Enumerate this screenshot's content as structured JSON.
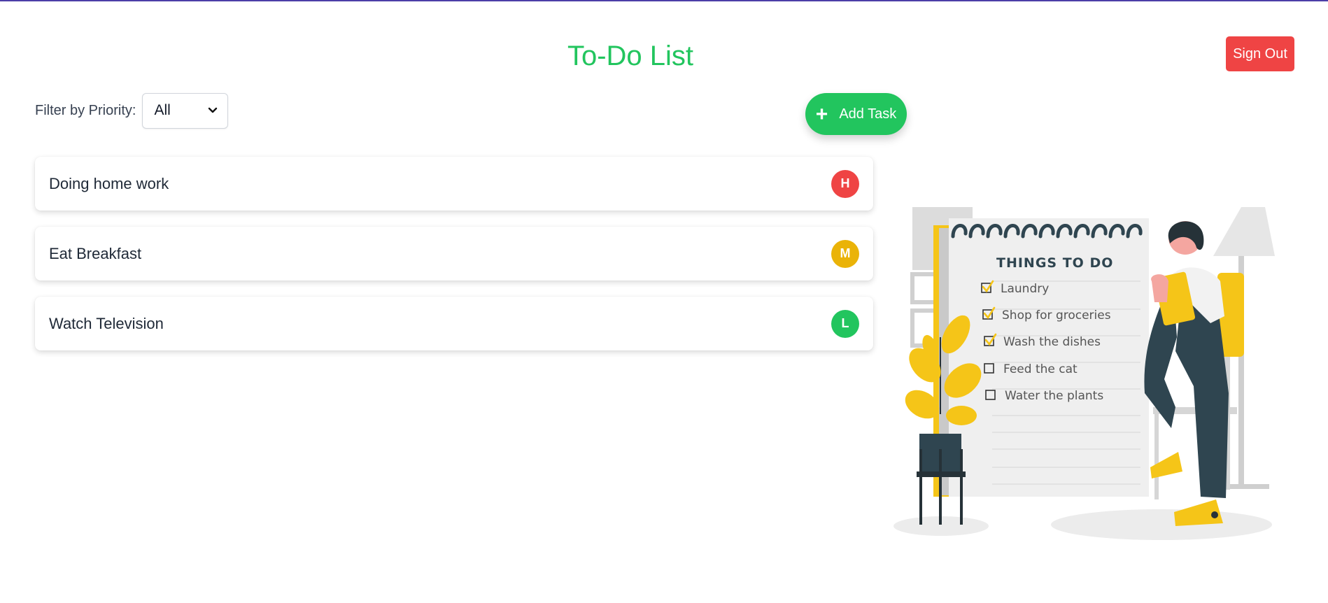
{
  "header": {
    "title": "To-Do List",
    "signout_label": "Sign Out"
  },
  "filter": {
    "label": "Filter by Priority:",
    "selected": "All"
  },
  "add_task": {
    "icon": "+",
    "label": "Add Task"
  },
  "tasks": [
    {
      "title": "Doing home work",
      "priority": "H",
      "color": "#ef4444"
    },
    {
      "title": "Eat Breakfast",
      "priority": "M",
      "color": "#eab308"
    },
    {
      "title": "Watch Television",
      "priority": "L",
      "color": "#22c55e"
    }
  ],
  "illustration": {
    "heading": "THINGS TO DO",
    "items": [
      {
        "text": "Laundry",
        "checked": true
      },
      {
        "text": "Shop for groceries",
        "checked": true
      },
      {
        "text": "Wash the dishes",
        "checked": true
      },
      {
        "text": "Feed the cat",
        "checked": false
      },
      {
        "text": "Water the plants",
        "checked": false
      }
    ]
  },
  "colors": {
    "accent": "#22c55e",
    "danger": "#ef4444",
    "warning": "#eab308",
    "illustration_yellow": "#f5c518",
    "illustration_dark": "#2f4550"
  }
}
